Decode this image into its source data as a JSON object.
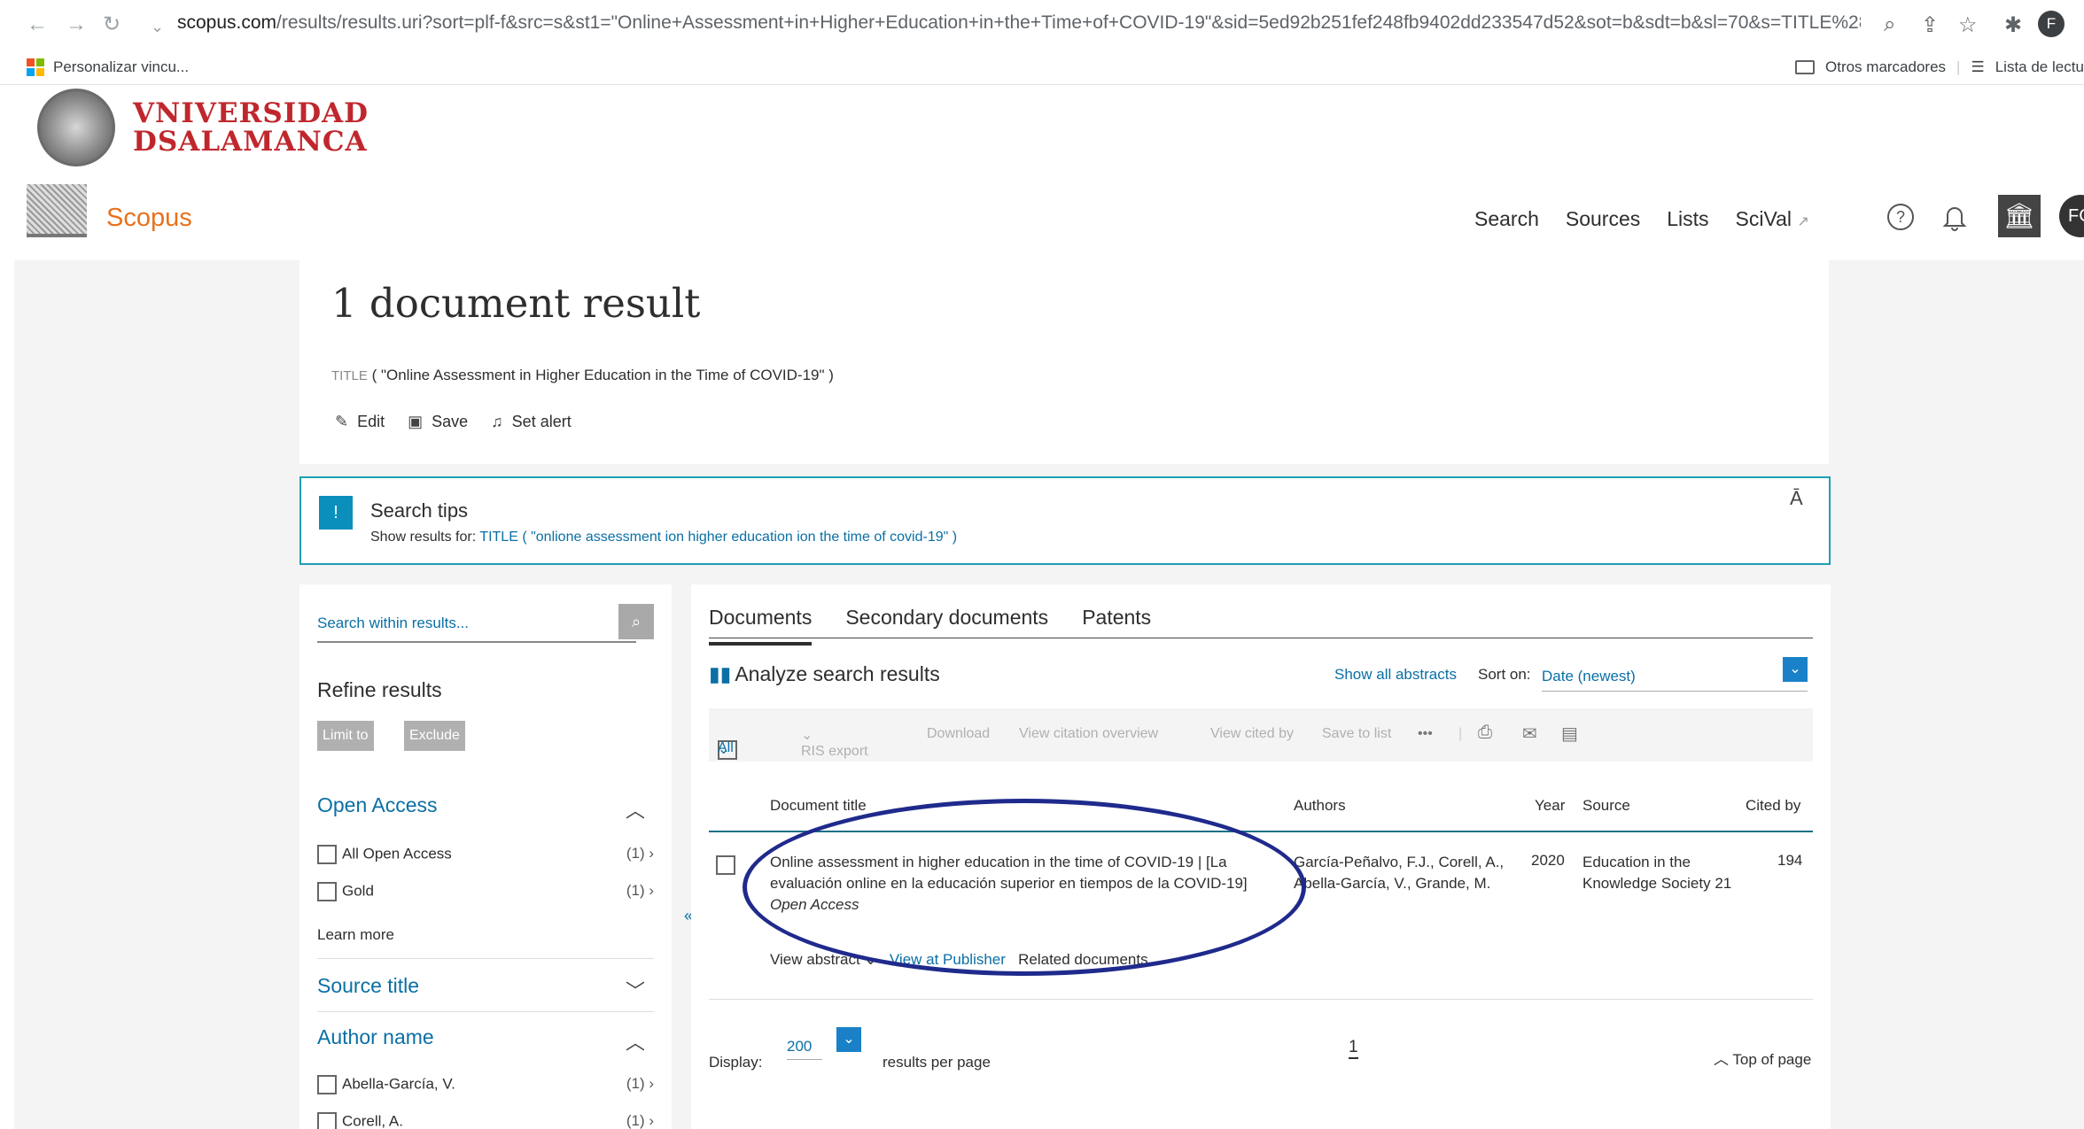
{
  "browser": {
    "url_domain": "scopus.com",
    "url_rest": "/results/results.uri?sort=plf-f&src=s&st1=\"Online+Assessment+in+Higher+Education+in+the+Time+of+COVID-19\"&sid=5ed92b251fef248fb9402dd233547d52&sot=b&sdt=b&sl=70&s=TITLE%28\"Onlin...",
    "bookmark_left": "Personalizar vincu...",
    "bookmark_other": "Otros marcadores",
    "reading_list": "Lista de lectu",
    "profile_initial": "F"
  },
  "university": {
    "line1": "VNIVERSIDAD",
    "line2": "DSALAMANCA"
  },
  "scopus": {
    "logo": "Scopus",
    "nav": [
      "Search",
      "Sources",
      "Lists",
      "SciVal"
    ],
    "scival_ext": "↗",
    "avatar": "FC"
  },
  "results": {
    "heading": "1 document result",
    "query_keyword": "TITLE",
    "query_text": "( \"Online Assessment in Higher Education in the Time of COVID-19\" )",
    "actions": [
      "Edit",
      "Save",
      "Set alert"
    ]
  },
  "tips": {
    "title": "Search tips",
    "prefix": "Show results for:",
    "suggestion": "TITLE ( \"onlione assessment ion higher education ion the time of covid-19\" )",
    "aa": "Ā"
  },
  "refine": {
    "search_placeholder": "Search within results...",
    "title": "Refine results",
    "limit_to": "Limit to",
    "exclude": "Exclude",
    "open_access": "Open Access",
    "oa_items": [
      {
        "label": "All Open Access",
        "count": "(1)"
      },
      {
        "label": "Gold",
        "count": "(1)"
      }
    ],
    "learn_more": "Learn more",
    "source_title": "Source title",
    "author_name": "Author name",
    "author_items": [
      {
        "label": "Abella-García, V.",
        "count": "(1)"
      },
      {
        "label": "Corell, A.",
        "count": "(1)"
      }
    ]
  },
  "documents": {
    "tabs": [
      "Documents",
      "Secondary documents",
      "Patents"
    ],
    "analyze": "Analyze search results",
    "show_all_abstracts": "Show all abstracts",
    "sort_label": "Sort on:",
    "sort_value": "Date (newest)",
    "toolbar": {
      "all": "All",
      "ris": "RIS export",
      "download": "Download",
      "citation": "View citation overview",
      "cited_by": "View cited by",
      "save_list": "Save to list",
      "more": "•••"
    },
    "columns": [
      "Document title",
      "Authors",
      "Year",
      "Source",
      "Cited by"
    ],
    "row": {
      "title": "Online assessment in higher education in the time of COVID-19 | [La evaluación online en la educación superior en tiempos de la COVID-19]",
      "open_access": "Open Access",
      "authors": "García-Peñalvo, F.J., Corell, A., Abella-García, V., Grande, M.",
      "year": "2020",
      "source": "Education in the Knowledge Society 21",
      "cited_by": "194",
      "view_abstract": "View abstract",
      "view_publisher": "View at Publisher",
      "related": "Related documents"
    },
    "display_label": "Display:",
    "display_value": "200",
    "per_page": "results per page",
    "page": "1",
    "top_of_page": "Top of page"
  }
}
